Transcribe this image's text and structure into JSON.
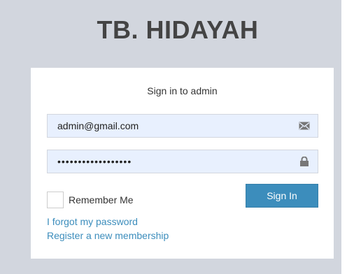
{
  "logo": {
    "text": "TB. HIDAYAH"
  },
  "login": {
    "message": "Sign in to admin",
    "email_value": "admin@gmail.com",
    "password_value": "••••••••••••••••••",
    "remember_label": "Remember Me",
    "remember_checked": false,
    "signin_label": "Sign In",
    "forgot_link": "I forgot my password",
    "register_link": "Register a new membership"
  },
  "icons": {
    "email": "envelope-icon",
    "password": "lock-icon"
  },
  "colors": {
    "background": "#d2d6de",
    "primary": "#3c8dbc",
    "autofill": "#e8f0fe",
    "title": "#444444"
  }
}
